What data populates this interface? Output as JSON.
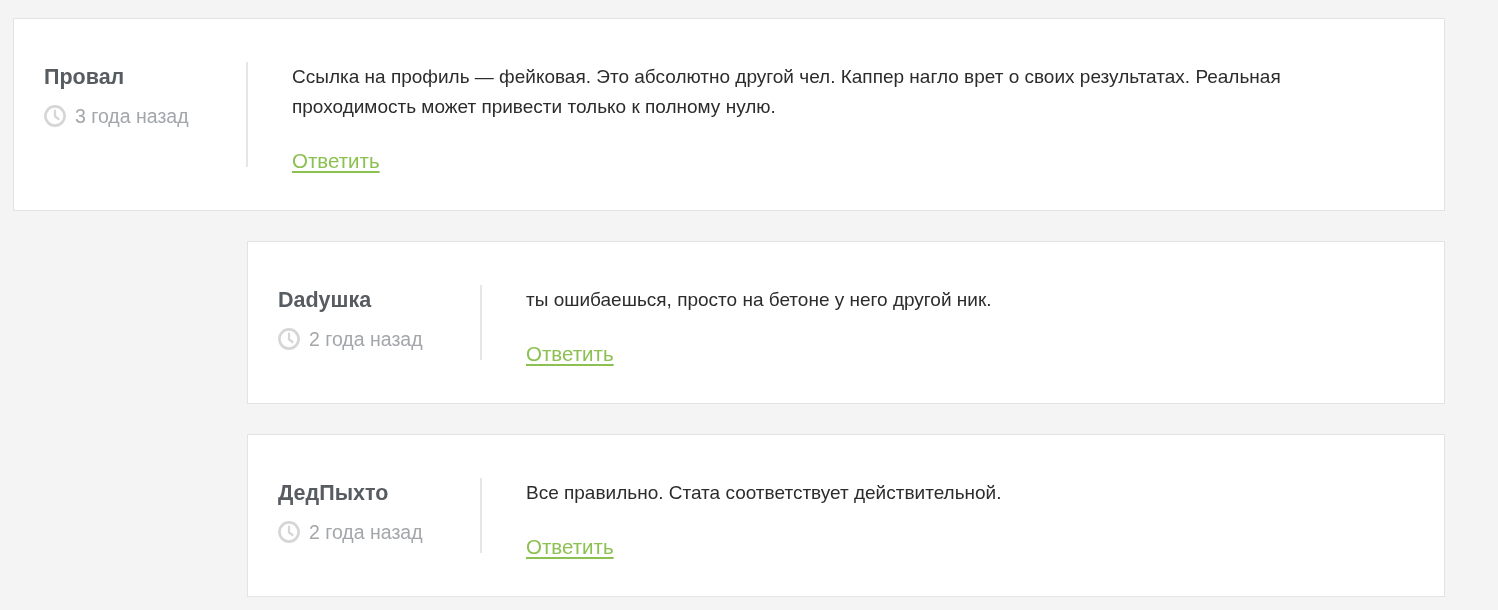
{
  "comments": [
    {
      "author": "Провал",
      "time": "3 года назад",
      "text": "Ссылка на профиль — фейковая. Это абсолютно другой чел. Каппер нагло врет о своих результатах. Реальная проходимость может привести только к полному нулю.",
      "reply_link": "Ответить",
      "children": [
        {
          "author": "Dadушка",
          "time": "2 года назад",
          "text": "ты ошибаешься, просто на бетоне у него другой ник.",
          "reply_link": "Ответить"
        },
        {
          "author": "ДедПыхто",
          "time": "2 года назад",
          "text": "Все правильно. Стата соответствует действительной.",
          "reply_link": "Ответить"
        }
      ]
    }
  ]
}
